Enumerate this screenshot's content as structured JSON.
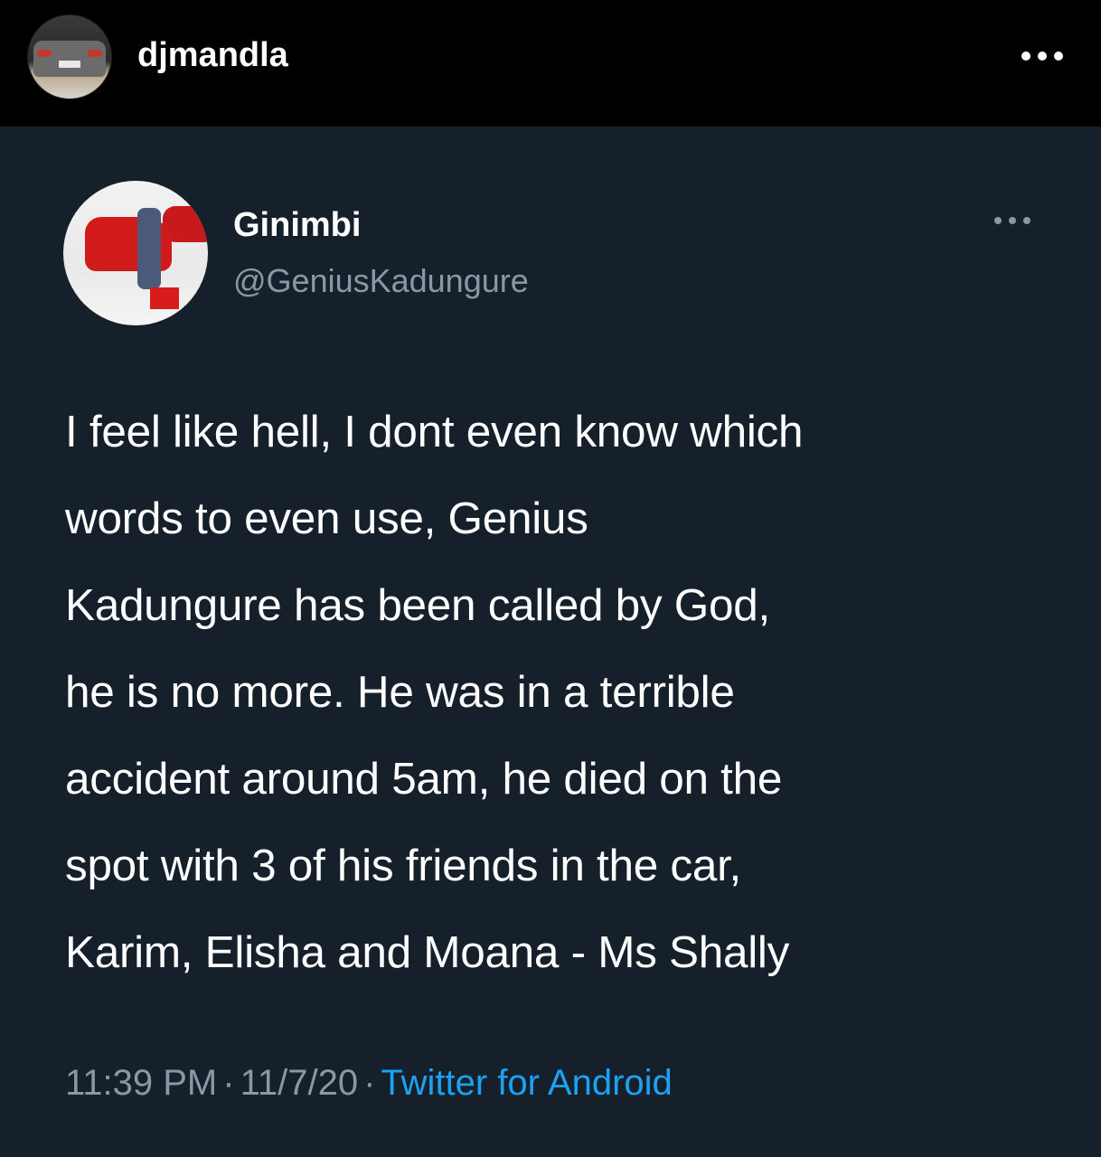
{
  "instagram": {
    "username": "djmandla",
    "more_icon": "more-horizontal-icon"
  },
  "tweet": {
    "display_name": "Ginimbi",
    "handle": "@GeniusKadungure",
    "more_icon": "more-horizontal-icon",
    "text": "I feel like hell, I dont even know which\nwords  to even use, Genius\nKadungure has been called by God,\nhe is no more. He was in a terrible\naccident  around 5am, he died on the\nspot with 3 of his friends  in the car,\nKarim, Elisha  and  Moana - Ms Shally",
    "time": "11:39 PM",
    "date": "11/7/20",
    "separator": "·",
    "source": "Twitter for Android"
  },
  "colors": {
    "ig_background": "#000000",
    "tweet_background": "#15202b",
    "text_primary": "#ffffff",
    "text_secondary": "#8899a6",
    "link": "#1da1f2"
  }
}
